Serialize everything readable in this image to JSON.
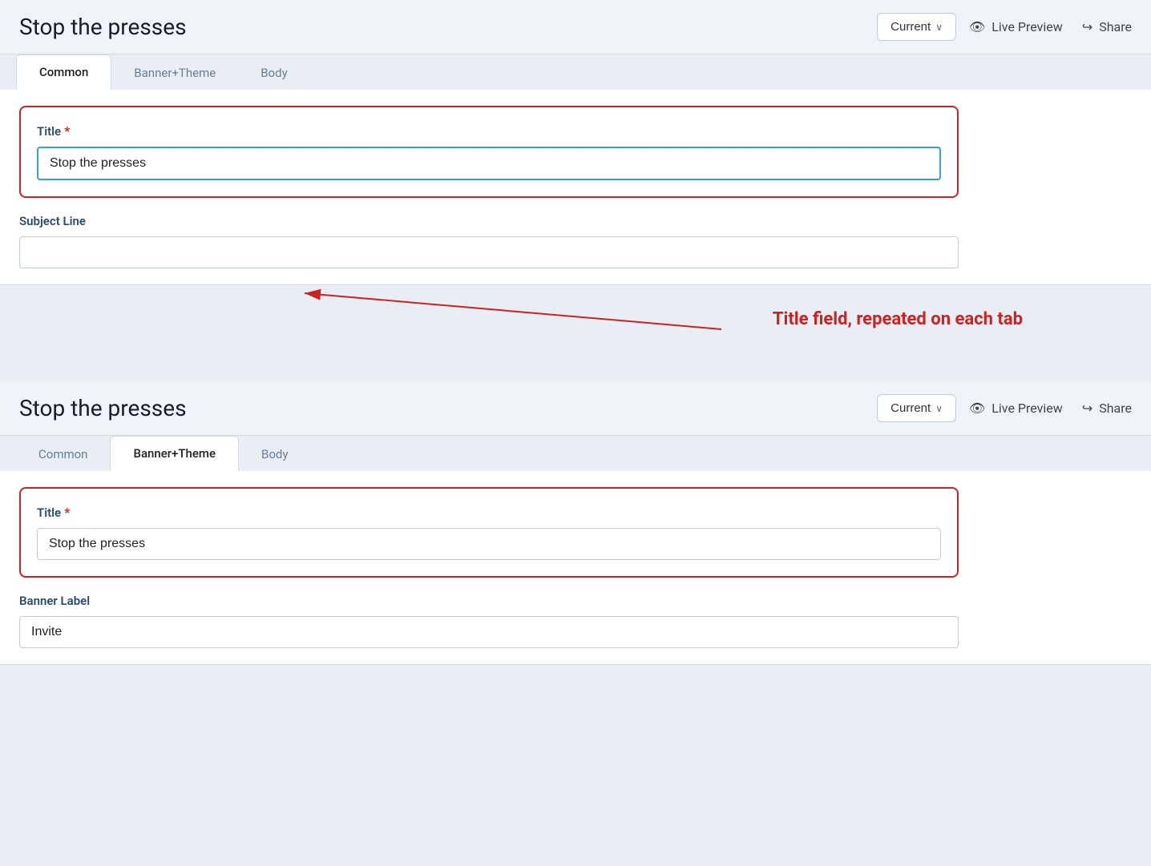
{
  "app": {
    "title": "Stop the presses"
  },
  "topPanel": {
    "title": "Stop the presses",
    "dropdown": {
      "label": "Current",
      "chevron": "∨"
    },
    "livePreview": {
      "label": "Live Preview",
      "icon": "👁"
    },
    "share": {
      "label": "Share",
      "icon": "↪"
    },
    "tabs": [
      {
        "id": "common",
        "label": "Common",
        "active": true
      },
      {
        "id": "banner-theme",
        "label": "Banner+Theme",
        "active": false
      },
      {
        "id": "body",
        "label": "Body",
        "active": false
      }
    ],
    "titleField": {
      "label": "Title",
      "required": true,
      "value": "Stop the presses",
      "placeholder": ""
    },
    "subjectLine": {
      "label": "Subject Line",
      "value": "",
      "placeholder": ""
    }
  },
  "annotation": {
    "text": "Title field, repeated on each tab"
  },
  "bottomPanel": {
    "title": "Stop the presses",
    "dropdown": {
      "label": "Current",
      "chevron": "∨"
    },
    "livePreview": {
      "label": "Live Preview",
      "icon": "👁"
    },
    "share": {
      "label": "Share",
      "icon": "↪"
    },
    "tabs": [
      {
        "id": "common",
        "label": "Common",
        "active": false
      },
      {
        "id": "banner-theme",
        "label": "Banner+Theme",
        "active": true
      },
      {
        "id": "body",
        "label": "Body",
        "active": false
      }
    ],
    "titleField": {
      "label": "Title",
      "required": true,
      "value": "Stop the presses",
      "placeholder": ""
    },
    "bannerLabel": {
      "label": "Banner Label",
      "value": "Invite",
      "placeholder": ""
    }
  }
}
